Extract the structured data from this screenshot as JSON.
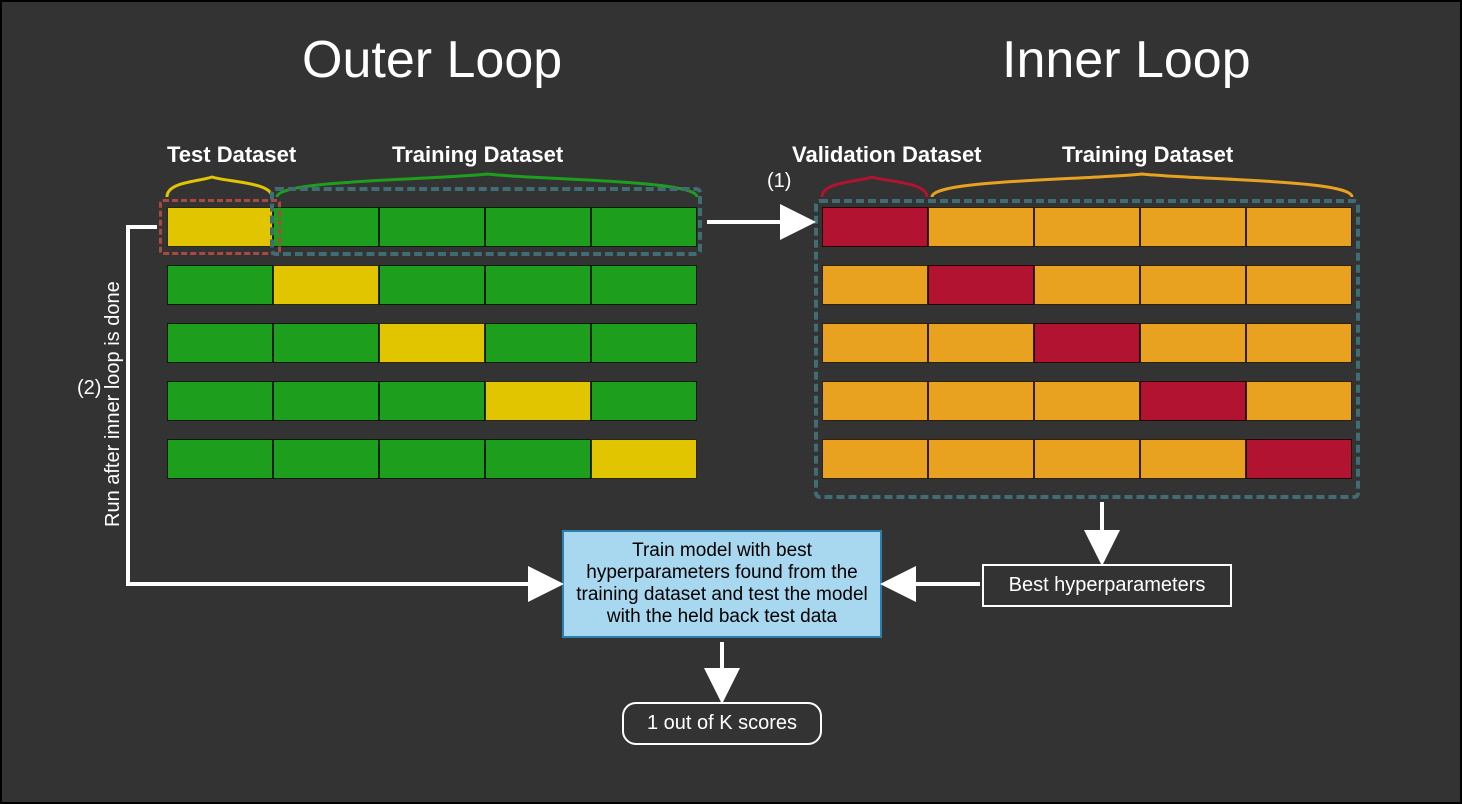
{
  "titles": {
    "outer": "Outer Loop",
    "inner": "Inner Loop"
  },
  "labels": {
    "test_dataset": "Test Dataset",
    "training_dataset_left": "Training Dataset",
    "validation_dataset": "Validation Dataset",
    "training_dataset_right": "Training Dataset",
    "run_after": "Run after inner loop is done",
    "step1": "(1)",
    "step2": "(2)"
  },
  "boxes": {
    "train_model": "Train model with best hyperparameters found from the training dataset and test the model with the held back test data",
    "best_hyper": "Best hyperparameters",
    "scores": "1 out of K scores"
  },
  "grids": {
    "outer": [
      [
        "yellow",
        "green",
        "green",
        "green",
        "green"
      ],
      [
        "green",
        "yellow",
        "green",
        "green",
        "green"
      ],
      [
        "green",
        "green",
        "yellow",
        "green",
        "green"
      ],
      [
        "green",
        "green",
        "green",
        "yellow",
        "green"
      ],
      [
        "green",
        "green",
        "green",
        "green",
        "yellow"
      ]
    ],
    "inner": [
      [
        "red",
        "orange",
        "orange",
        "orange",
        "orange"
      ],
      [
        "orange",
        "red",
        "orange",
        "orange",
        "orange"
      ],
      [
        "orange",
        "orange",
        "red",
        "orange",
        "orange"
      ],
      [
        "orange",
        "orange",
        "orange",
        "red",
        "orange"
      ],
      [
        "orange",
        "orange",
        "orange",
        "orange",
        "red"
      ]
    ]
  },
  "colors": {
    "green": "#1d9e1d",
    "yellow": "#e0c500",
    "orange": "#e8a220",
    "red": "#b21330",
    "dashed": "#3f6d73",
    "blue_box_bg": "#a8d7f0",
    "blue_box_border": "#2a7faf"
  }
}
